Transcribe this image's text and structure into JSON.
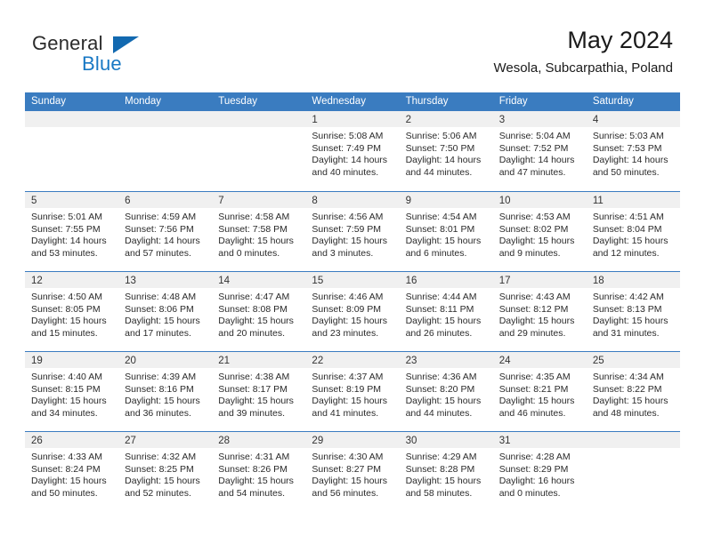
{
  "brand": {
    "name_top": "General",
    "name_bottom": "Blue",
    "accent_color": "#1269b0",
    "text_color": "#2b2b2b"
  },
  "header": {
    "title": "May 2024",
    "subtitle": "Wesola, Subcarpathia, Poland"
  },
  "calendar": {
    "header_bg": "#3a7cc0",
    "daynum_bg": "#f0f0f0",
    "weekday_headers": [
      "Sunday",
      "Monday",
      "Tuesday",
      "Wednesday",
      "Thursday",
      "Friday",
      "Saturday"
    ],
    "weeks": [
      [
        {
          "day": "",
          "sunrise": "",
          "sunset": "",
          "daylight1": "",
          "daylight2": ""
        },
        {
          "day": "",
          "sunrise": "",
          "sunset": "",
          "daylight1": "",
          "daylight2": ""
        },
        {
          "day": "",
          "sunrise": "",
          "sunset": "",
          "daylight1": "",
          "daylight2": ""
        },
        {
          "day": "1",
          "sunrise": "Sunrise: 5:08 AM",
          "sunset": "Sunset: 7:49 PM",
          "daylight1": "Daylight: 14 hours",
          "daylight2": "and 40 minutes."
        },
        {
          "day": "2",
          "sunrise": "Sunrise: 5:06 AM",
          "sunset": "Sunset: 7:50 PM",
          "daylight1": "Daylight: 14 hours",
          "daylight2": "and 44 minutes."
        },
        {
          "day": "3",
          "sunrise": "Sunrise: 5:04 AM",
          "sunset": "Sunset: 7:52 PM",
          "daylight1": "Daylight: 14 hours",
          "daylight2": "and 47 minutes."
        },
        {
          "day": "4",
          "sunrise": "Sunrise: 5:03 AM",
          "sunset": "Sunset: 7:53 PM",
          "daylight1": "Daylight: 14 hours",
          "daylight2": "and 50 minutes."
        }
      ],
      [
        {
          "day": "5",
          "sunrise": "Sunrise: 5:01 AM",
          "sunset": "Sunset: 7:55 PM",
          "daylight1": "Daylight: 14 hours",
          "daylight2": "and 53 minutes."
        },
        {
          "day": "6",
          "sunrise": "Sunrise: 4:59 AM",
          "sunset": "Sunset: 7:56 PM",
          "daylight1": "Daylight: 14 hours",
          "daylight2": "and 57 minutes."
        },
        {
          "day": "7",
          "sunrise": "Sunrise: 4:58 AM",
          "sunset": "Sunset: 7:58 PM",
          "daylight1": "Daylight: 15 hours",
          "daylight2": "and 0 minutes."
        },
        {
          "day": "8",
          "sunrise": "Sunrise: 4:56 AM",
          "sunset": "Sunset: 7:59 PM",
          "daylight1": "Daylight: 15 hours",
          "daylight2": "and 3 minutes."
        },
        {
          "day": "9",
          "sunrise": "Sunrise: 4:54 AM",
          "sunset": "Sunset: 8:01 PM",
          "daylight1": "Daylight: 15 hours",
          "daylight2": "and 6 minutes."
        },
        {
          "day": "10",
          "sunrise": "Sunrise: 4:53 AM",
          "sunset": "Sunset: 8:02 PM",
          "daylight1": "Daylight: 15 hours",
          "daylight2": "and 9 minutes."
        },
        {
          "day": "11",
          "sunrise": "Sunrise: 4:51 AM",
          "sunset": "Sunset: 8:04 PM",
          "daylight1": "Daylight: 15 hours",
          "daylight2": "and 12 minutes."
        }
      ],
      [
        {
          "day": "12",
          "sunrise": "Sunrise: 4:50 AM",
          "sunset": "Sunset: 8:05 PM",
          "daylight1": "Daylight: 15 hours",
          "daylight2": "and 15 minutes."
        },
        {
          "day": "13",
          "sunrise": "Sunrise: 4:48 AM",
          "sunset": "Sunset: 8:06 PM",
          "daylight1": "Daylight: 15 hours",
          "daylight2": "and 17 minutes."
        },
        {
          "day": "14",
          "sunrise": "Sunrise: 4:47 AM",
          "sunset": "Sunset: 8:08 PM",
          "daylight1": "Daylight: 15 hours",
          "daylight2": "and 20 minutes."
        },
        {
          "day": "15",
          "sunrise": "Sunrise: 4:46 AM",
          "sunset": "Sunset: 8:09 PM",
          "daylight1": "Daylight: 15 hours",
          "daylight2": "and 23 minutes."
        },
        {
          "day": "16",
          "sunrise": "Sunrise: 4:44 AM",
          "sunset": "Sunset: 8:11 PM",
          "daylight1": "Daylight: 15 hours",
          "daylight2": "and 26 minutes."
        },
        {
          "day": "17",
          "sunrise": "Sunrise: 4:43 AM",
          "sunset": "Sunset: 8:12 PM",
          "daylight1": "Daylight: 15 hours",
          "daylight2": "and 29 minutes."
        },
        {
          "day": "18",
          "sunrise": "Sunrise: 4:42 AM",
          "sunset": "Sunset: 8:13 PM",
          "daylight1": "Daylight: 15 hours",
          "daylight2": "and 31 minutes."
        }
      ],
      [
        {
          "day": "19",
          "sunrise": "Sunrise: 4:40 AM",
          "sunset": "Sunset: 8:15 PM",
          "daylight1": "Daylight: 15 hours",
          "daylight2": "and 34 minutes."
        },
        {
          "day": "20",
          "sunrise": "Sunrise: 4:39 AM",
          "sunset": "Sunset: 8:16 PM",
          "daylight1": "Daylight: 15 hours",
          "daylight2": "and 36 minutes."
        },
        {
          "day": "21",
          "sunrise": "Sunrise: 4:38 AM",
          "sunset": "Sunset: 8:17 PM",
          "daylight1": "Daylight: 15 hours",
          "daylight2": "and 39 minutes."
        },
        {
          "day": "22",
          "sunrise": "Sunrise: 4:37 AM",
          "sunset": "Sunset: 8:19 PM",
          "daylight1": "Daylight: 15 hours",
          "daylight2": "and 41 minutes."
        },
        {
          "day": "23",
          "sunrise": "Sunrise: 4:36 AM",
          "sunset": "Sunset: 8:20 PM",
          "daylight1": "Daylight: 15 hours",
          "daylight2": "and 44 minutes."
        },
        {
          "day": "24",
          "sunrise": "Sunrise: 4:35 AM",
          "sunset": "Sunset: 8:21 PM",
          "daylight1": "Daylight: 15 hours",
          "daylight2": "and 46 minutes."
        },
        {
          "day": "25",
          "sunrise": "Sunrise: 4:34 AM",
          "sunset": "Sunset: 8:22 PM",
          "daylight1": "Daylight: 15 hours",
          "daylight2": "and 48 minutes."
        }
      ],
      [
        {
          "day": "26",
          "sunrise": "Sunrise: 4:33 AM",
          "sunset": "Sunset: 8:24 PM",
          "daylight1": "Daylight: 15 hours",
          "daylight2": "and 50 minutes."
        },
        {
          "day": "27",
          "sunrise": "Sunrise: 4:32 AM",
          "sunset": "Sunset: 8:25 PM",
          "daylight1": "Daylight: 15 hours",
          "daylight2": "and 52 minutes."
        },
        {
          "day": "28",
          "sunrise": "Sunrise: 4:31 AM",
          "sunset": "Sunset: 8:26 PM",
          "daylight1": "Daylight: 15 hours",
          "daylight2": "and 54 minutes."
        },
        {
          "day": "29",
          "sunrise": "Sunrise: 4:30 AM",
          "sunset": "Sunset: 8:27 PM",
          "daylight1": "Daylight: 15 hours",
          "daylight2": "and 56 minutes."
        },
        {
          "day": "30",
          "sunrise": "Sunrise: 4:29 AM",
          "sunset": "Sunset: 8:28 PM",
          "daylight1": "Daylight: 15 hours",
          "daylight2": "and 58 minutes."
        },
        {
          "day": "31",
          "sunrise": "Sunrise: 4:28 AM",
          "sunset": "Sunset: 8:29 PM",
          "daylight1": "Daylight: 16 hours",
          "daylight2": "and 0 minutes."
        },
        {
          "day": "",
          "sunrise": "",
          "sunset": "",
          "daylight1": "",
          "daylight2": ""
        }
      ]
    ]
  }
}
